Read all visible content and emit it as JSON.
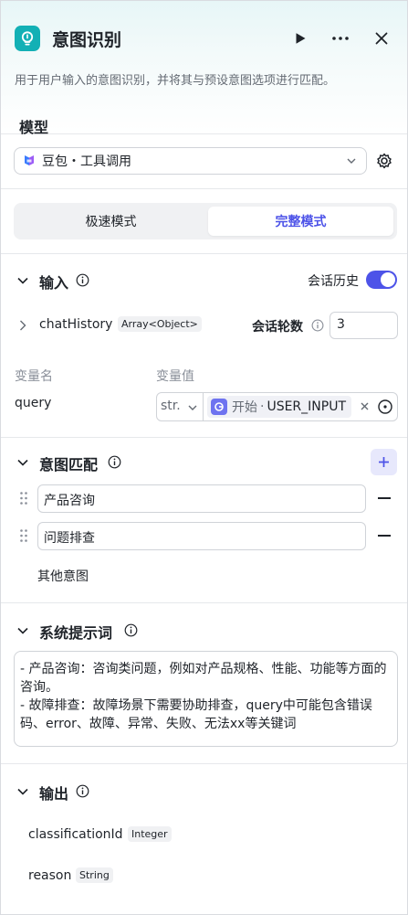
{
  "header": {
    "title": "意图识别",
    "description": "用于用户输入的意图识别，并将其与预设意图选项进行匹配。"
  },
  "model": {
    "section_title": "模型",
    "selected": "豆包・工具调用"
  },
  "mode": {
    "fast_label": "极速模式",
    "full_label": "完整模式",
    "active": "完整模式"
  },
  "input": {
    "section_title": "输入",
    "history_label": "会话历史",
    "history_enabled": true,
    "chat_history_name": "chatHistory",
    "chat_history_type": "Array<Object>",
    "rounds_label": "会话轮数",
    "rounds_value": "3",
    "var_name_header": "变量名",
    "var_value_header": "变量值",
    "var_name": "query",
    "var_type": "str.",
    "ref_source": "开始",
    "ref_separator": "·",
    "ref_var": "USER_INPUT"
  },
  "intents": {
    "section_title": "意图匹配",
    "items": [
      "产品咨询",
      "问题排查"
    ],
    "other_label": "其他意图"
  },
  "system_prompt": {
    "section_title": "系统提示词",
    "lines": [
      "- 产品咨询：咨询类问题，例如对产品规格、性能、功能等方面的咨询。",
      "- 故障排查：故障场景下需要协助排查，query中可能包含错误码、error、故障、异常、失败、无法xx等关键词"
    ]
  },
  "output": {
    "section_title": "输出",
    "fields": [
      {
        "name": "classificationId",
        "type": "Integer"
      },
      {
        "name": "reason",
        "type": "String"
      }
    ]
  },
  "colors": {
    "accent": "#4d53e8",
    "node_icon": "#13b0b5",
    "border": "#d0d3d8"
  },
  "icons": [
    "lightbulb-icon",
    "play-icon",
    "more-icon",
    "close-icon",
    "gear-icon",
    "chevron-down-icon",
    "info-icon",
    "chevron-right-icon",
    "plus-icon",
    "drag-handle-icon",
    "minus-icon",
    "target-icon"
  ]
}
